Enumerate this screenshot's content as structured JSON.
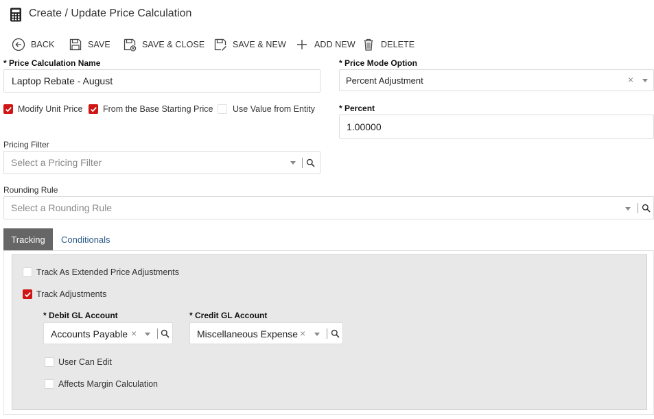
{
  "header": {
    "title": "Create / Update Price Calculation",
    "icon": "calculator-icon"
  },
  "toolbar": {
    "back": "BACK",
    "save": "SAVE",
    "save_close": "SAVE & CLOSE",
    "save_new": "SAVE & NEW",
    "add_new": "ADD NEW",
    "delete": "DELETE"
  },
  "form": {
    "name_label": "* Price Calculation Name",
    "name_value": "Laptop Rebate - August",
    "mode_label": "* Price Mode Option",
    "mode_value": "Percent Adjustment",
    "modify_unit_price": "Modify Unit Price",
    "from_base": "From the Base Starting Price",
    "use_value_entity": "Use Value from Entity",
    "percent_label": "* Percent",
    "percent_value": "1.00000",
    "pricing_filter_label": "Pricing Filter",
    "pricing_filter_placeholder": "Select a Pricing Filter",
    "rounding_rule_label": "Rounding Rule",
    "rounding_rule_placeholder": "Select a Rounding Rule"
  },
  "checkboxes": {
    "modify_unit_price": true,
    "from_base": true,
    "use_value_entity": false,
    "track_extended": false,
    "track_adjustments": true,
    "user_can_edit": false,
    "affects_margin": false
  },
  "tabs": {
    "tracking": "Tracking",
    "conditionals": "Conditionals"
  },
  "tracking": {
    "track_extended": "Track As Extended Price Adjustments",
    "track_adjustments": "Track Adjustments",
    "debit_label": "* Debit GL Account",
    "debit_value": "Accounts Payable",
    "credit_label": "* Credit GL Account",
    "credit_value": "Miscellaneous Expense",
    "user_can_edit": "User Can Edit",
    "affects_margin": "Affects Margin Calculation"
  },
  "colors": {
    "accent_red": "#d01515",
    "tab_active_bg": "#666666",
    "link_blue": "#2e5b8a",
    "panel_bg": "#e8e8e8"
  }
}
